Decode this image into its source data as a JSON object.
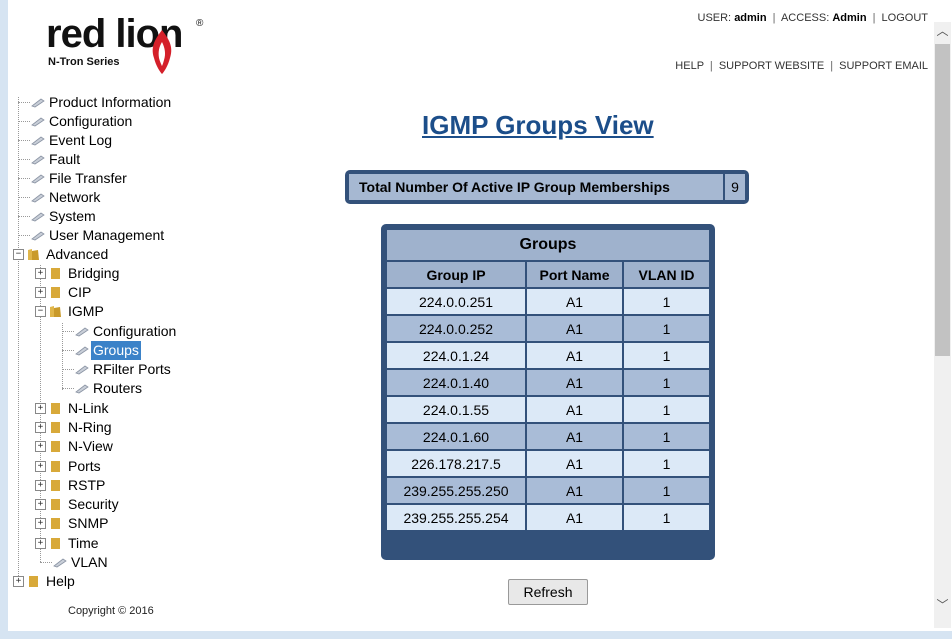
{
  "logo": {
    "word": "red lion",
    "sub": "N-Tron Series",
    "reg": "®"
  },
  "userbar": {
    "user_label": "USER:",
    "user": "admin",
    "access_label": "ACCESS:",
    "access": "Admin",
    "logout": "LOGOUT"
  },
  "links": {
    "help": "HELP",
    "support_website": "SUPPORT WEBSITE",
    "support_email": "SUPPORT EMAIL"
  },
  "tree": {
    "product_info": "Product Information",
    "configuration": "Configuration",
    "event_log": "Event Log",
    "fault": "Fault",
    "file_transfer": "File Transfer",
    "network": "Network",
    "system": "System",
    "user_management": "User Management",
    "advanced": "Advanced",
    "bridging": "Bridging",
    "cip": "CIP",
    "igmp": "IGMP",
    "igmp_configuration": "Configuration",
    "igmp_groups": "Groups",
    "igmp_rfilter": "RFilter Ports",
    "igmp_routers": "Routers",
    "nlink": "N-Link",
    "nring": "N-Ring",
    "nview": "N-View",
    "ports": "Ports",
    "rstp": "RSTP",
    "security": "Security",
    "snmp": "SNMP",
    "time": "Time",
    "vlan": "VLAN",
    "help": "Help"
  },
  "copyright": "Copyright © 2016",
  "page_title": "IGMP Groups View",
  "total": {
    "label": "Total Number Of Active IP Group Memberships",
    "value": "9"
  },
  "groups": {
    "caption": "Groups",
    "headers": [
      "Group IP",
      "Port Name",
      "VLAN ID"
    ],
    "rows": [
      [
        "224.0.0.251",
        "A1",
        "1"
      ],
      [
        "224.0.0.252",
        "A1",
        "1"
      ],
      [
        "224.0.1.24",
        "A1",
        "1"
      ],
      [
        "224.0.1.40",
        "A1",
        "1"
      ],
      [
        "224.0.1.55",
        "A1",
        "1"
      ],
      [
        "224.0.1.60",
        "A1",
        "1"
      ],
      [
        "226.178.217.5",
        "A1",
        "1"
      ],
      [
        "239.255.255.250",
        "A1",
        "1"
      ],
      [
        "239.255.255.254",
        "A1",
        "1"
      ]
    ]
  },
  "refresh_label": "Refresh",
  "colors": {
    "title": "#1c4e8a",
    "table_border": "#33517a",
    "selection": "#3b82c8"
  }
}
